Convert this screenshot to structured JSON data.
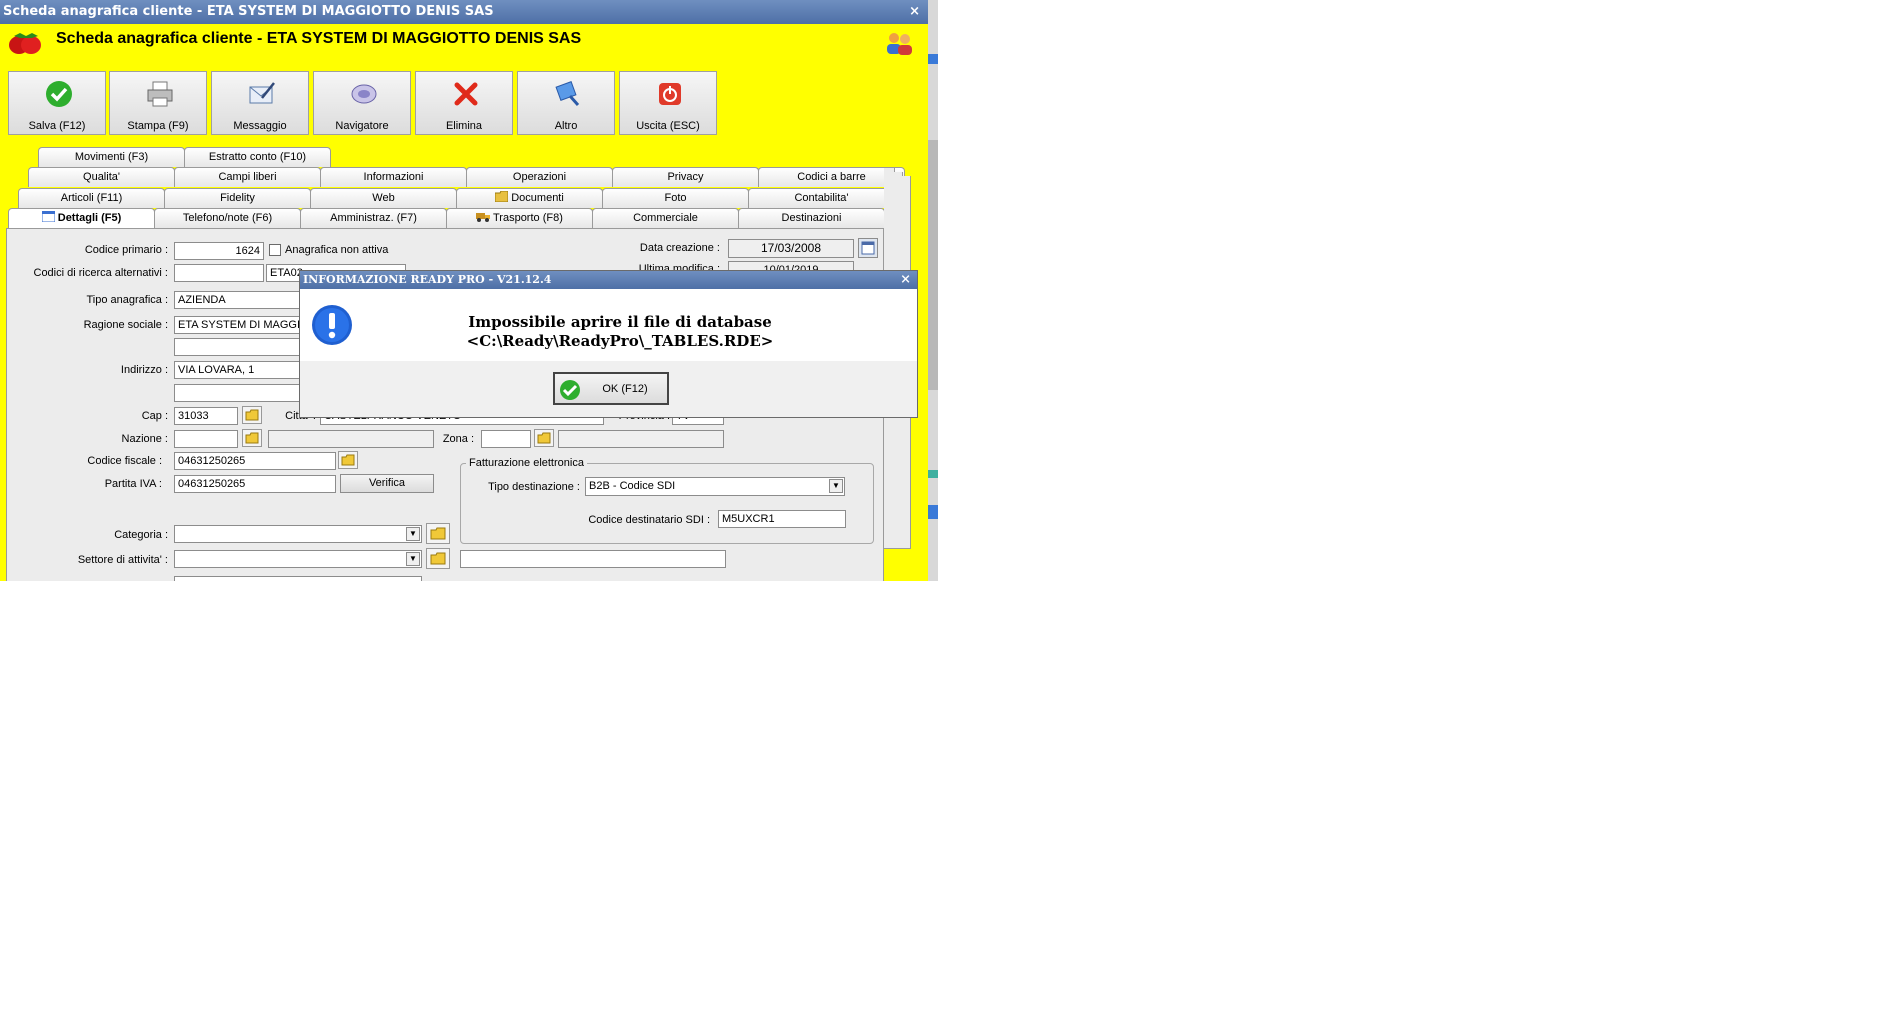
{
  "window": {
    "title": "Scheda anagrafica cliente - ETA SYSTEM DI MAGGIOTTO DENIS SAS",
    "header": "Scheda anagrafica cliente - ETA SYSTEM DI MAGGIOTTO DENIS SAS",
    "close": "×"
  },
  "toolbar": [
    {
      "label": "Salva (F12)",
      "icon": "check-icon"
    },
    {
      "label": "Stampa (F9)",
      "icon": "printer-icon"
    },
    {
      "label": "Messaggio",
      "icon": "message-icon"
    },
    {
      "label": "Navigatore",
      "icon": "navigator-icon"
    },
    {
      "label": "Elimina",
      "icon": "delete-icon"
    },
    {
      "label": "Altro",
      "icon": "other-icon"
    },
    {
      "label": "Uscita (ESC)",
      "icon": "exit-icon"
    }
  ],
  "tabs": {
    "row1": [
      "Movimenti (F3)",
      "Estratto conto (F10)"
    ],
    "row2": [
      "Qualita'",
      "Campi liberi",
      "Informazioni",
      "Operazioni",
      "Privacy",
      "Codici a barre"
    ],
    "row3": [
      "Articoli (F11)",
      "Fidelity",
      "Web",
      "Documenti",
      "Foto",
      "Contabilita'"
    ],
    "row4": [
      "Dettagli (F5)",
      "Telefono/note (F6)",
      "Amministraz. (F7)",
      "Trasporto (F8)",
      "Commerciale",
      "Destinazioni"
    ]
  },
  "form": {
    "codice_primario_label": "Codice primario :",
    "codice_primario": "1624",
    "non_attiva_label": "Anagrafica non attiva",
    "codici_alt_label": "Codici di ricerca alternativi :",
    "codice_alt2": "ETA02",
    "data_creazione_label": "Data creazione :",
    "data_creazione": "17/03/2008",
    "ultima_modifica_label": "Ultima modifica :",
    "ultima_modifica": "10/01/2019",
    "tipo_label": "Tipo anagrafica :",
    "tipo": "AZIENDA",
    "ragione_label": "Ragione sociale :",
    "ragione": "ETA SYSTEM DI MAGGIOTTO DENIS SAS",
    "indirizzo_label": "Indirizzo :",
    "indirizzo": "VIA LOVARA, 1",
    "cap_label": "Cap :",
    "cap": "31033",
    "citta_label": "Citta' :",
    "citta": "CASTELFRANCO VENETO",
    "provincia_label": "Provincia :",
    "provincia": "TV",
    "nazione_label": "Nazione :",
    "zona_label": "Zona :",
    "cf_label": "Codice fiscale :",
    "cf": "04631250265",
    "piva_label": "Partita IVA :",
    "piva": "04631250265",
    "verifica": "Verifica",
    "fe_label": "Fatturazione elettronica",
    "tipo_dest_label": "Tipo destinazione :",
    "tipo_dest": "B2B - Codice SDI",
    "sdi_label": "Codice destinatario SDI :",
    "sdi": "M5UXCR1",
    "categoria_label": "Categoria :",
    "settore_label": "Settore di attivita' :"
  },
  "dialog": {
    "title": "INFORMAZIONE READY PRO - V21.12.4",
    "close": "×",
    "line1": "Impossibile aprire il file di database",
    "line2": "<C:\\Ready\\ReadyPro\\_TABLES.RDE>",
    "ok": "OK (F12)"
  }
}
